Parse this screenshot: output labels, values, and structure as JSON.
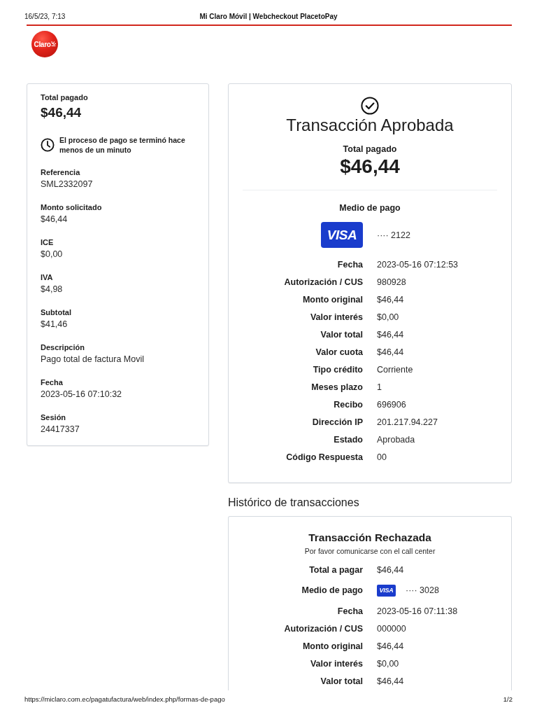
{
  "print_header": {
    "date": "16/5/23, 7:13",
    "title": "Mi Claro Móvil | Webcheckout PlacetoPay"
  },
  "logo": {
    "text": "Claro"
  },
  "summary": {
    "total_label": "Total pagado",
    "total_value": "$46,44",
    "notice": "El proceso de pago se terminó hace menos de un minuto",
    "fields": [
      {
        "label": "Referencia",
        "value": "SML2332097"
      },
      {
        "label": "Monto solicitado",
        "value": "$46,44"
      },
      {
        "label": "ICE",
        "value": "$0,00"
      },
      {
        "label": "IVA",
        "value": "$4,98"
      },
      {
        "label": "Subtotal",
        "value": "$41,46"
      },
      {
        "label": "Descripción",
        "value": "Pago total de factura Movil"
      },
      {
        "label": "Fecha",
        "value": "2023-05-16 07:10:32"
      },
      {
        "label": "Sesión",
        "value": "24417337"
      }
    ]
  },
  "transaction": {
    "title": "Transacción Aprobada",
    "total_label": "Total pagado",
    "total_value": "$46,44",
    "payment_heading": "Medio de pago",
    "card_brand": "VISA",
    "card_number": "···· 2122",
    "details": [
      {
        "label": "Fecha",
        "value": "2023-05-16 07:12:53"
      },
      {
        "label": "Autorización / CUS",
        "value": "980928"
      },
      {
        "label": "Monto original",
        "value": "$46,44"
      },
      {
        "label": "Valor interés",
        "value": "$0,00"
      },
      {
        "label": "Valor total",
        "value": "$46,44"
      },
      {
        "label": "Valor cuota",
        "value": "$46,44"
      },
      {
        "label": "Tipo crédito",
        "value": "Corriente"
      },
      {
        "label": "Meses plazo",
        "value": "1"
      },
      {
        "label": "Recibo",
        "value": "696906"
      },
      {
        "label": "Dirección IP",
        "value": "201.217.94.227"
      },
      {
        "label": "Estado",
        "value": "Aprobada"
      },
      {
        "label": "Código Respuesta",
        "value": "00"
      }
    ]
  },
  "history": {
    "heading": "Histórico de transacciones",
    "transactions": [
      {
        "title": "Transacción Rechazada",
        "message": "Por favor comunicarse con el call center",
        "details": [
          {
            "kind": "text",
            "label": "Total a pagar",
            "value": "$46,44"
          },
          {
            "kind": "card",
            "label": "Medio de pago",
            "card_brand": "VISA",
            "card_number": "···· 3028"
          },
          {
            "kind": "text",
            "label": "Fecha",
            "value": "2023-05-16 07:11:38"
          },
          {
            "kind": "text",
            "label": "Autorización / CUS",
            "value": "000000"
          },
          {
            "kind": "text",
            "label": "Monto original",
            "value": "$46,44"
          },
          {
            "kind": "text",
            "label": "Valor interés",
            "value": "$0,00"
          },
          {
            "kind": "text",
            "label": "Valor total",
            "value": "$46,44"
          }
        ]
      }
    ]
  },
  "footer": {
    "url": "https://miclaro.com.ec/pagatufactura/web/index.php/formas-de-pago",
    "page": "1/2"
  }
}
